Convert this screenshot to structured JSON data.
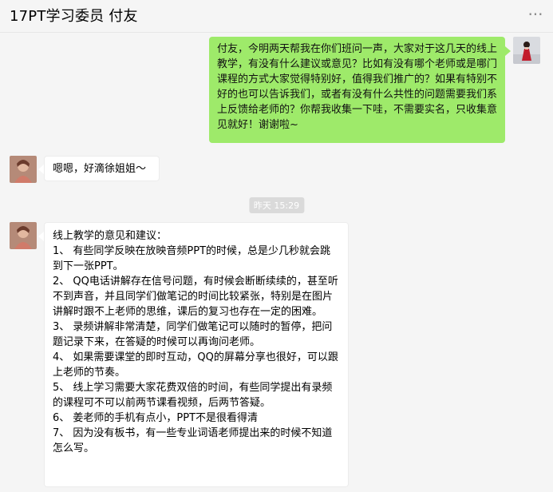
{
  "header": {
    "title": "17PT学习委员 付友",
    "more_icon": "more-icon"
  },
  "messages": [
    {
      "from": "me",
      "text": "付友，今明两天帮我在你们班问一声，大家对于这几天的线上教学，有没有什么建议或意见？比如有没有哪个老师或是哪门课程的方式大家觉得特别好，值得我们推广的？如果有特别不好的也可以告诉我们，或者有没有什么共性的问题需要我们系上反馈给老师的？你帮我收集一下哇，不需要实名，只收集意见就好！谢谢啦~"
    },
    {
      "from": "other",
      "text": "嗯嗯，好滴徐姐姐～"
    },
    {
      "time": "昨天 15:29"
    },
    {
      "from": "other",
      "heading": "线上教学的意见和建议：",
      "items": [
        "1、 有些同学反映在放映音频PPT的时候，总是少几秒就会跳到下一张PPT。",
        "2、 QQ电话讲解存在信号问题，有时候会断断续续的，甚至听不到声音，并且同学们做笔记的时间比较紧张，特别是在图片讲解时跟不上老师的思维，课后的复习也存在一定的困难。",
        "3、 录频讲解非常清楚，同学们做笔记可以随时的暂停，把问题记录下来，在答疑的时候可以再询问老师。",
        "4、 如果需要课堂的即时互动，QQ的屏幕分享也很好，可以跟上老师的节奏。",
        "5、 线上学习需要大家花费双倍的时间，有些同学提出有录频的课程可不可以前两节课看视频，后两节答疑。",
        "6、 姜老师的手机有点小，PPT不是很看得清",
        "7、 因为没有板书，有一些专业词语老师提出来的时候不知道怎么写。"
      ]
    }
  ]
}
